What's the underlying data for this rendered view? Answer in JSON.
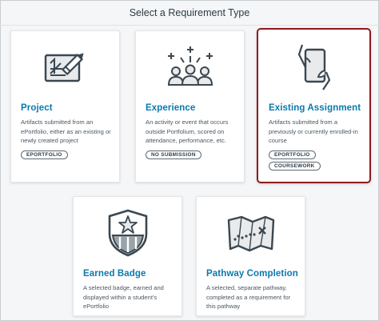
{
  "dialog": {
    "title": "Select a Requirement Type"
  },
  "colors": {
    "accent": "#0b79ae",
    "selected_border": "#8e1a1f"
  },
  "cards": [
    {
      "title": "Project",
      "description": "Artifacts submitted from an ePortfolio, either as an existing or newly created project",
      "tags": [
        "EPORTFOLIO"
      ],
      "icon": "project-board-pencil-icon"
    },
    {
      "title": "Experience",
      "description": "An activity or event that occurs outside Portfolium, scored on attendance, performance, etc.",
      "tags": [
        "NO SUBMISSION"
      ],
      "icon": "people-group-icon"
    },
    {
      "title": "Existing Assignment",
      "description": "Artifacts submitted from a previously or currently enrolled-in course",
      "tags": [
        "EPORTFOLIO",
        "COURSEWORK"
      ],
      "icon": "hand-holding-tablet-icon",
      "selected": true
    },
    {
      "title": "Earned Badge",
      "description": "A selected badge, earned and displayed within a student's ePortfolio",
      "tags": [],
      "icon": "shield-star-badge-icon"
    },
    {
      "title": "Pathway Completion",
      "description": "A selected, separate pathway, completed as a requirement for this pathway",
      "tags": [],
      "icon": "treasure-map-icon"
    }
  ]
}
